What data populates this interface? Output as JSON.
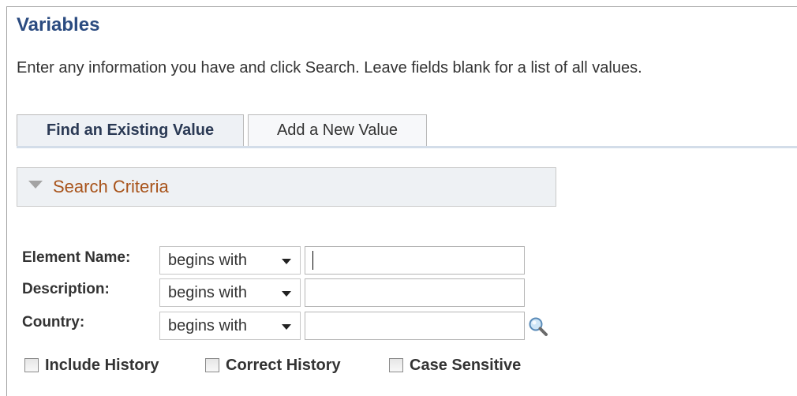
{
  "page": {
    "title": "Variables",
    "instructions": "Enter any information you have and click Search. Leave fields blank for a list of all values."
  },
  "tabs": [
    {
      "label": "Find an Existing Value",
      "active": true
    },
    {
      "label": "Add a New Value",
      "active": false
    }
  ],
  "search_criteria": {
    "label": "Search Criteria",
    "label_color": "#a8531a"
  },
  "fields": [
    {
      "label": "Element Name:",
      "operator": "begins with",
      "value": ""
    },
    {
      "label": "Description:",
      "operator": "begins with",
      "value": ""
    },
    {
      "label": "Country:",
      "operator": "begins with",
      "value": "",
      "lookup_icon": "magnifier-icon"
    }
  ],
  "checkboxes": [
    {
      "label": "Include History",
      "checked": false
    },
    {
      "label": "Correct History",
      "checked": false
    },
    {
      "label": "Case Sensitive",
      "checked": false
    }
  ],
  "colors": {
    "title": "#2b4b80",
    "tab_active_bg": "#eef1f5",
    "criteria_bg": "#eef1f4"
  }
}
